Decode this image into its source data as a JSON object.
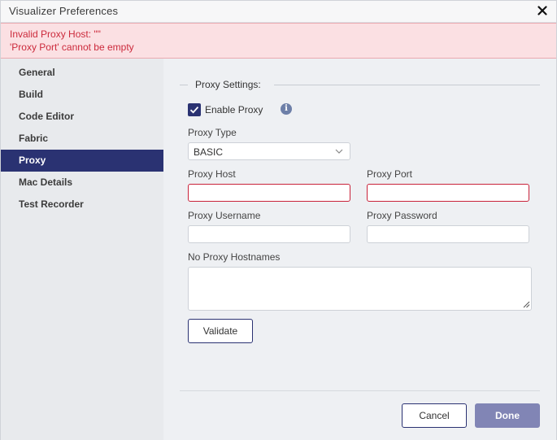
{
  "window": {
    "title": "Visualizer Preferences",
    "close_glyph": "✕"
  },
  "errors": {
    "line1": "Invalid Proxy Host: \"\"",
    "line2": "'Proxy Port' cannot be empty"
  },
  "sidebar": {
    "items": [
      {
        "label": "General",
        "active": false
      },
      {
        "label": "Build",
        "active": false
      },
      {
        "label": "Code Editor",
        "active": false
      },
      {
        "label": "Fabric",
        "active": false
      },
      {
        "label": "Proxy",
        "active": true
      },
      {
        "label": "Mac Details",
        "active": false
      },
      {
        "label": "Test Recorder",
        "active": false
      }
    ]
  },
  "proxy": {
    "section_title": "Proxy Settings:",
    "enable_label": "Enable Proxy",
    "enable_checked": true,
    "info_glyph": "i",
    "type_label": "Proxy Type",
    "type_value": "BASIC",
    "host_label": "Proxy Host",
    "host_value": "",
    "port_label": "Proxy Port",
    "port_value": "",
    "username_label": "Proxy Username",
    "username_value": "",
    "password_label": "Proxy Password",
    "password_value": "",
    "no_proxy_label": "No Proxy Hostnames",
    "no_proxy_value": "",
    "validate_label": "Validate"
  },
  "footer": {
    "cancel_label": "Cancel",
    "done_label": "Done"
  },
  "colors": {
    "accent": "#2a3272",
    "error_text": "#cc2a3c",
    "error_bg": "#fbe0e3",
    "done_bg": "#8185b5"
  }
}
